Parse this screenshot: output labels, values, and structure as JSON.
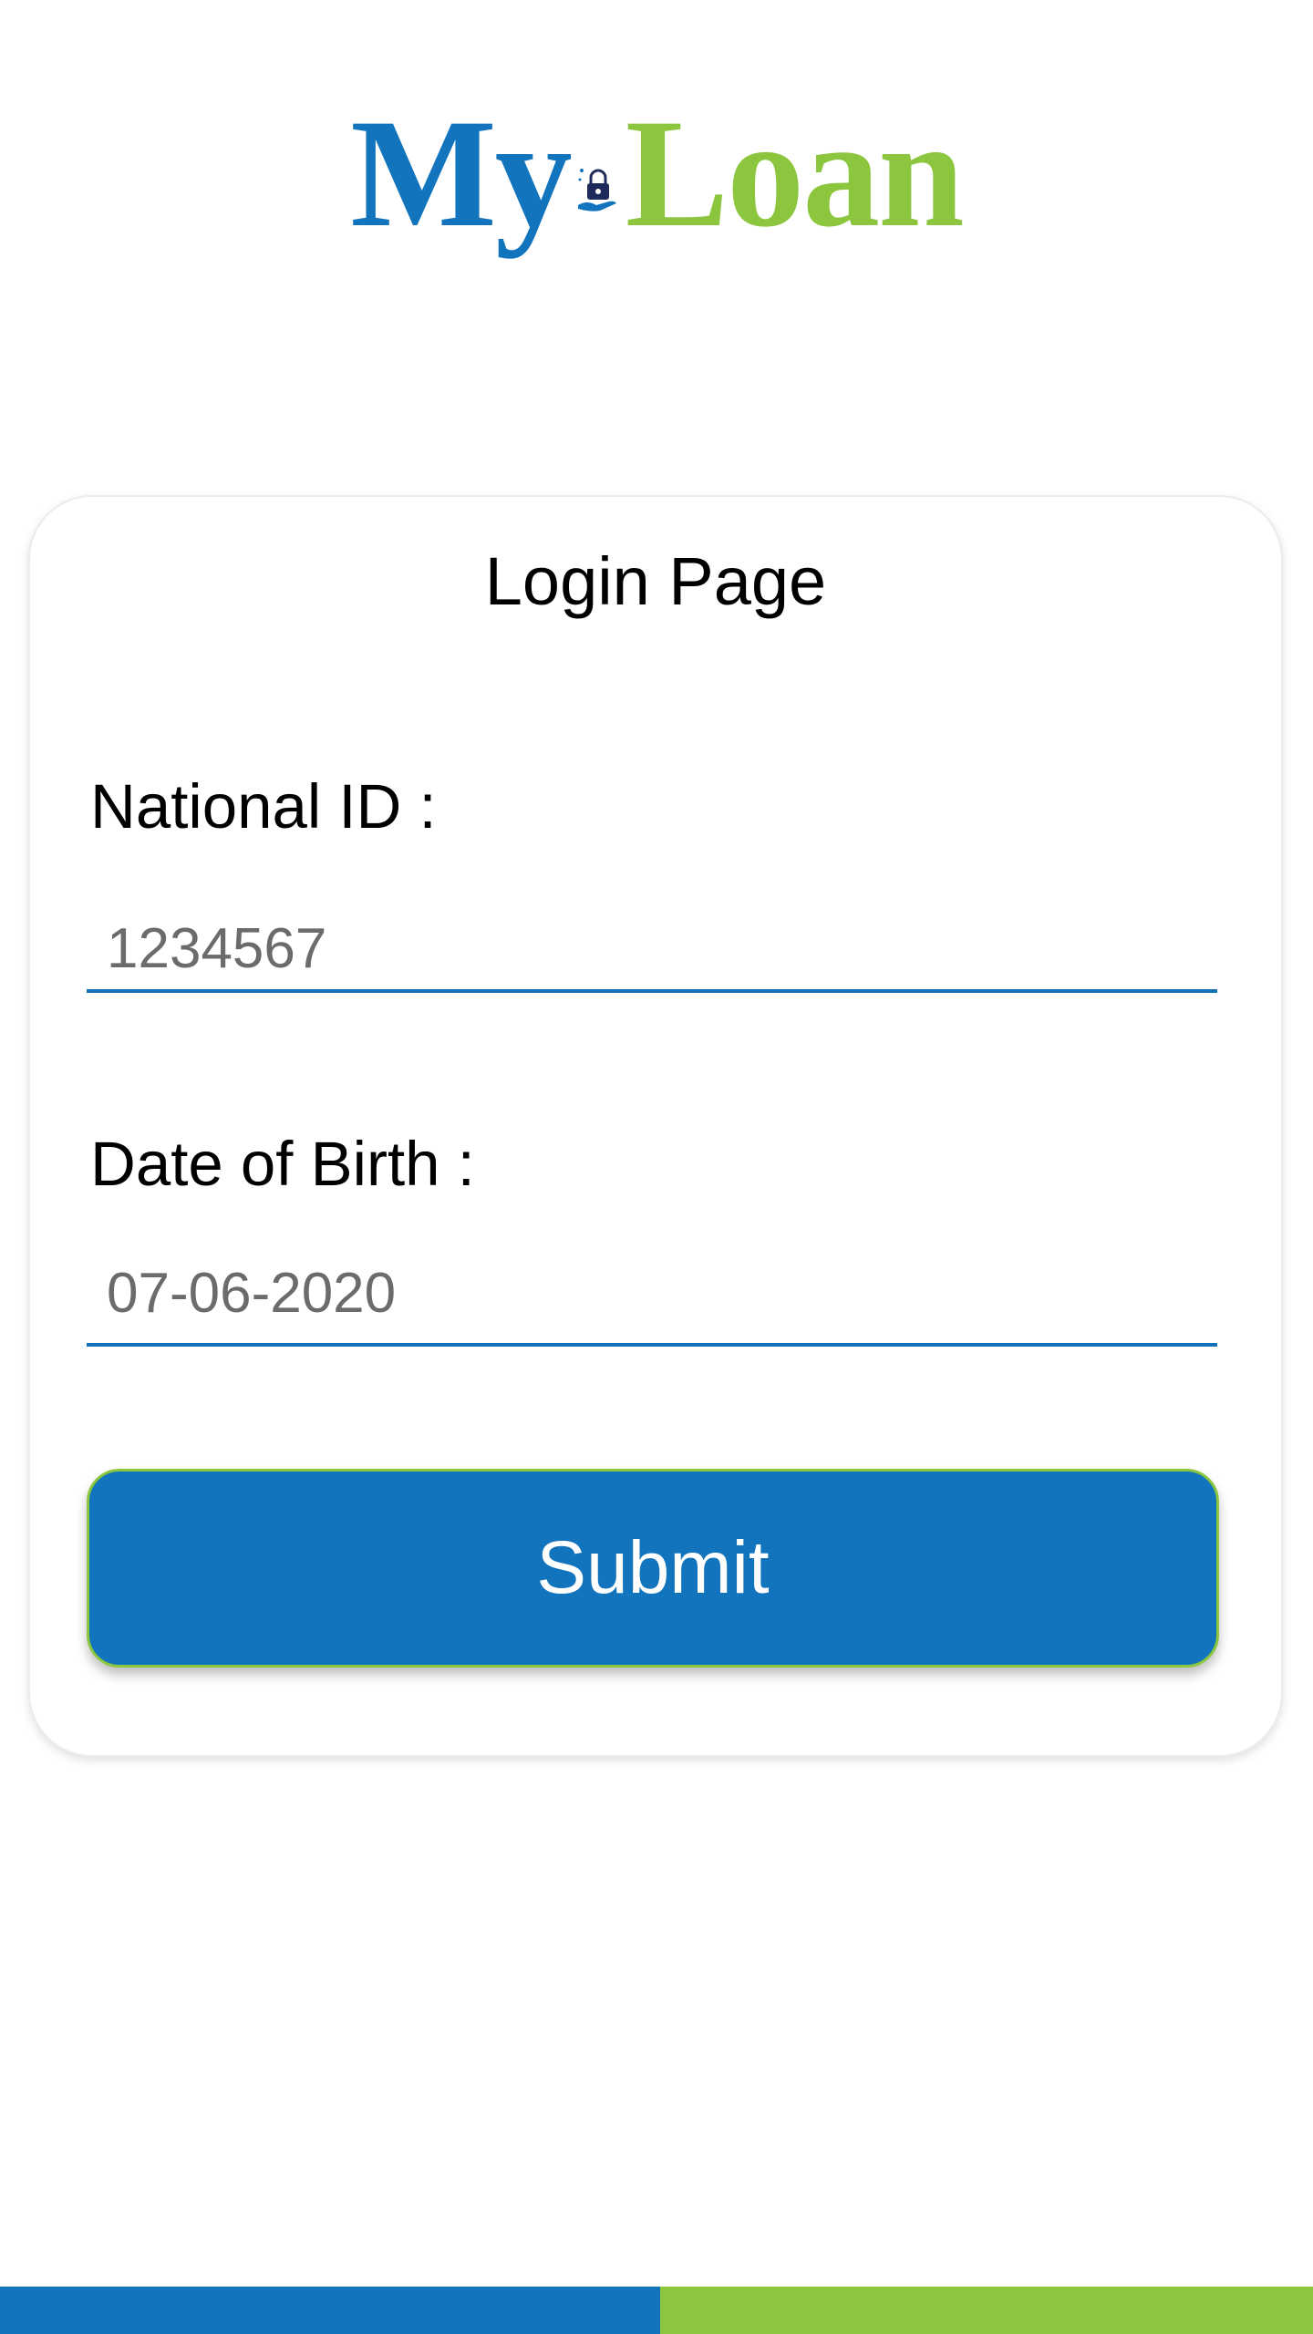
{
  "logo": {
    "part1": "My",
    "part2": "Loan",
    "colors": {
      "my": "#1174bd",
      "loan": "#8cc63e"
    },
    "mark_icon": "hand-lock-icon"
  },
  "login_card": {
    "title": "Login Page",
    "national_id": {
      "label": "National ID :",
      "value": "1234567"
    },
    "date_of_birth": {
      "label": "Date of Birth :",
      "value": "07-06-2020"
    },
    "submit_label": "Submit"
  },
  "theme": {
    "primary": "#1174bd",
    "accent": "#8cc63e"
  }
}
